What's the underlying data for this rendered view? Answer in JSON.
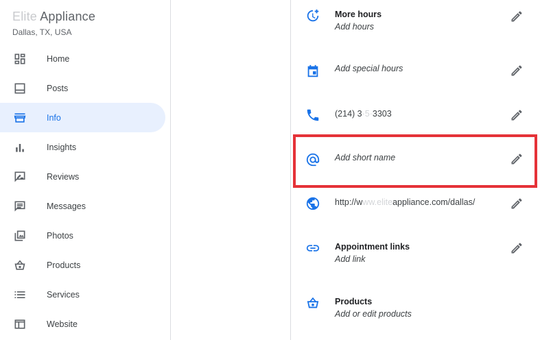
{
  "business": {
    "name_faded": "Elite",
    "name_visible": " Appliance",
    "location": "Dallas, TX, USA"
  },
  "sidebar": {
    "items": [
      {
        "label": "Home",
        "icon": "dashboard-icon"
      },
      {
        "label": "Posts",
        "icon": "posts-icon"
      },
      {
        "label": "Info",
        "icon": "storefront-icon",
        "active": true
      },
      {
        "label": "Insights",
        "icon": "bar-chart-icon"
      },
      {
        "label": "Reviews",
        "icon": "rate-review-icon"
      },
      {
        "label": "Messages",
        "icon": "message-icon"
      },
      {
        "label": "Photos",
        "icon": "photo-library-icon"
      },
      {
        "label": "Products",
        "icon": "basket-icon"
      },
      {
        "label": "Services",
        "icon": "list-icon"
      },
      {
        "label": "Website",
        "icon": "web-icon"
      }
    ]
  },
  "info": {
    "more_hours": {
      "title": "More hours",
      "subtitle": "Add hours"
    },
    "special_hours": {
      "subtitle": "Add special hours"
    },
    "phone": {
      "prefix": "(214) 3",
      "blurred": "·5·",
      "suffix": "3303"
    },
    "short_name": {
      "subtitle": "Add short name"
    },
    "website": {
      "prefix": "http://w",
      "blurred": "ww.elite",
      "suffix": "appliance.com/dallas/"
    },
    "appointment": {
      "title": "Appointment links",
      "subtitle": "Add link"
    },
    "products": {
      "title": "Products",
      "subtitle": "Add or edit products"
    }
  },
  "colors": {
    "accent": "#1a73e8",
    "active_bg": "#e8f0fe",
    "highlight": "#e53238",
    "icon_gray": "#5f6368"
  }
}
